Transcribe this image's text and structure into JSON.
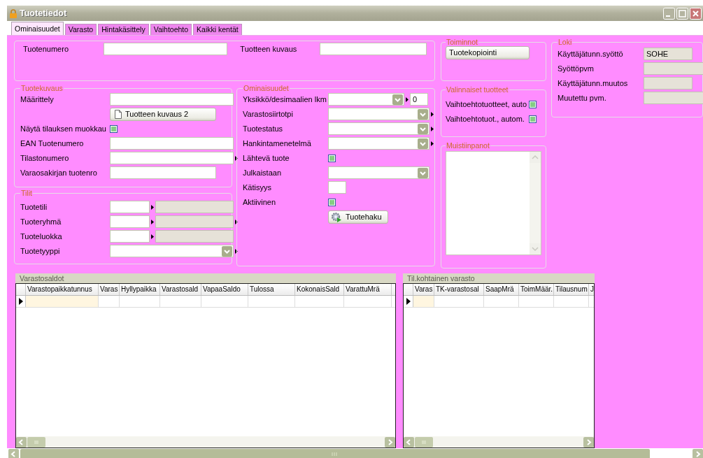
{
  "window": {
    "title": "Tuotetiedot"
  },
  "tabs": [
    {
      "label": "Ominaisuudet",
      "selected": true
    },
    {
      "label": "Varasto",
      "selected": false
    },
    {
      "label": "Hintakäsittely",
      "selected": false
    },
    {
      "label": "Vaihtoehto",
      "selected": false
    },
    {
      "label": "Kaikki kentät",
      "selected": false
    }
  ],
  "header": {
    "fields": [
      {
        "label": "Tuotenumero",
        "kind": "text"
      },
      {
        "label": "Tuotteen kuvaus",
        "kind": "text"
      }
    ]
  },
  "toiminnot": {
    "title": "Toiminnot",
    "fields": [
      {
        "label": "Tuotekopiointi",
        "kind": "button"
      }
    ]
  },
  "tuotekuvaus": {
    "title": "Tuotekuvaus",
    "fields": [
      {
        "label": "Määrittely",
        "kind": "text"
      },
      {
        "label": "Tuotteen kuvaus 2",
        "kind": "doc_button"
      },
      {
        "label": "Näytä tilauksen muokkau",
        "kind": "check",
        "checked": false
      },
      {
        "label": "EAN Tuotenumero",
        "kind": "text"
      },
      {
        "label": "Tilastonumero",
        "kind": "text",
        "link": true
      },
      {
        "label": "Varaosakirjan tuotenro",
        "kind": "short"
      }
    ]
  },
  "tilit": {
    "title": "Tilit",
    "fields": [
      {
        "label": "Tuotetili",
        "kind": "split"
      },
      {
        "label": "Tuoteryhmä",
        "kind": "split",
        "link": true
      },
      {
        "label": "Tuoteluokka",
        "kind": "split"
      },
      {
        "label": "Tuotetyyppi",
        "kind": "combo",
        "link": true
      }
    ]
  },
  "ominaisuudet": {
    "title": "Ominaisuudet",
    "fields": [
      {
        "label": "Yksikkö/desimaalien lkm",
        "kind": "number_combo",
        "value": "0"
      },
      {
        "label": "Varastosiirtotpi",
        "kind": "combo",
        "link": true
      },
      {
        "label": "Tuotestatus",
        "kind": "combo",
        "link": true
      },
      {
        "label": "Hankintamenetelmä",
        "kind": "combo",
        "link": true
      },
      {
        "label": "Lähtevä tuote",
        "kind": "check",
        "checked": false
      },
      {
        "label": "Julkaistaan",
        "kind": "combo"
      },
      {
        "label": "Kätisyys",
        "kind": "tiny"
      },
      {
        "label": "Aktiivinen",
        "kind": "check",
        "checked": false
      },
      {
        "label": "Tuotehaku",
        "kind": "gear_button"
      }
    ]
  },
  "valinnaiset_tuotteet": {
    "title": "Valinnaiset tuotteet",
    "fields": [
      {
        "label": "Vaihtoehtotuotteet, auto",
        "kind": "check",
        "checked": false
      },
      {
        "label": "Vaihtoehtotuot., autom.",
        "kind": "check",
        "checked": false
      }
    ]
  },
  "muistiinpanot": {
    "title": "Muistiinpanot"
  },
  "loki": {
    "title": "Loki",
    "fields": [
      {
        "label": "Käyttäjätunn.syöttö",
        "kind": "readonly_short",
        "value": "SOHE"
      },
      {
        "label": "Syöttöpvm",
        "kind": "readonly"
      },
      {
        "label": "Käyttäjätunn.muutos",
        "kind": "readonly_short"
      },
      {
        "label": "Muutettu pvm.",
        "kind": "readonly"
      }
    ]
  },
  "varastosaldot": {
    "title": "Varastosaldot",
    "columns": [
      "Varastopaikkatunnus",
      "Varas",
      "Hyllypaikka",
      "Varastosald",
      "VapaaSaldo",
      "Tulossa",
      "KokonaisSald",
      "VarattuMrä"
    ],
    "rows": [
      {
        "selected": true
      }
    ]
  },
  "til_kohtainen_varasto": {
    "title": "Til.kohtainen varasto",
    "columns": [
      "Varas",
      "TK-varastosal",
      "SaapMrä",
      "ToimMäär.",
      "Tilausnum",
      "J"
    ],
    "rows": [
      {
        "selected": true
      }
    ]
  }
}
